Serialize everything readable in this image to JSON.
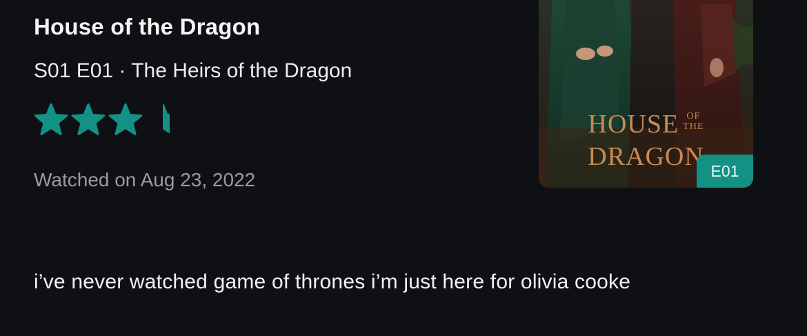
{
  "show": {
    "title": "House of the Dragon",
    "episode_line": "S01 E01 · The Heirs of the Dragon"
  },
  "rating": {
    "value": 3.5,
    "max": 5,
    "star_icon": "star-icon",
    "color": "#149185"
  },
  "watched": {
    "text": "Watched on Aug 23, 2022"
  },
  "review": {
    "text": "i’ve never watched game of thrones i’m just here for olivia cooke"
  },
  "poster": {
    "logo_line1": "HOUSE",
    "logo_small_top": "OF",
    "logo_small_bottom": "THE",
    "logo_line2": "DRAGON",
    "badge": "E01"
  }
}
